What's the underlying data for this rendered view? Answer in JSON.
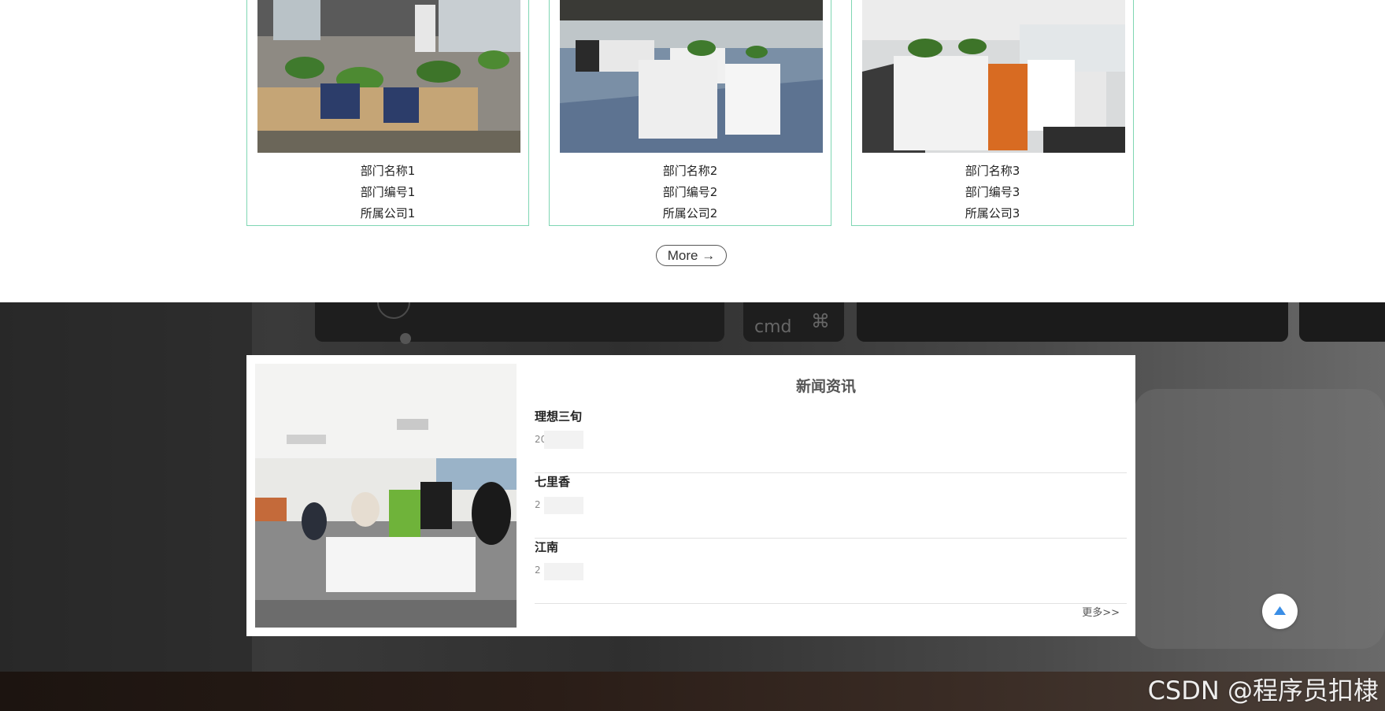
{
  "departments": {
    "cards": [
      {
        "name": "部门名称1",
        "code": "部门编号1",
        "company": "所属公司1"
      },
      {
        "name": "部门名称2",
        "code": "部门编号2",
        "company": "所属公司2"
      },
      {
        "name": "部门名称3",
        "code": "部门编号3",
        "company": "所属公司3"
      }
    ],
    "more_label": "More →"
  },
  "news": {
    "title": "新闻资讯",
    "items": [
      {
        "title": "理想三旬",
        "date": "20"
      },
      {
        "title": "七里香",
        "date": "2               3"
      },
      {
        "title": "江南",
        "date": "2               3"
      }
    ],
    "more_label": "更多>>"
  },
  "watermark": "CSDN @程序员扣棣",
  "colors": {
    "card_border": "#7fd6b3",
    "accent_blue": "#3a8ee6",
    "dark_band": "#2f2f2f"
  },
  "icons": {
    "back_to_top": "triangle-up-icon"
  }
}
